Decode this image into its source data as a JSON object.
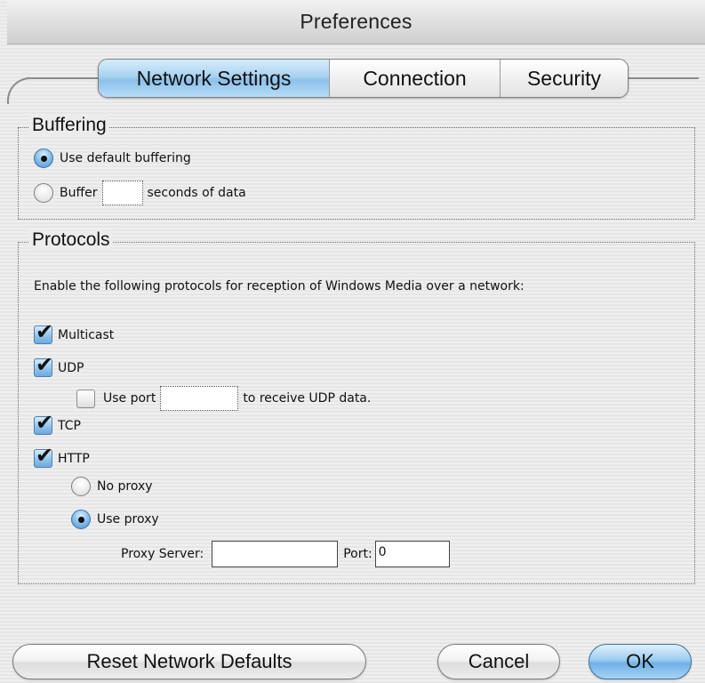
{
  "window": {
    "title": "Preferences"
  },
  "tabs": [
    {
      "label": "Network Settings",
      "active": true
    },
    {
      "label": "Connection",
      "active": false
    },
    {
      "label": "Security",
      "active": false
    }
  ],
  "buffering": {
    "title": "Buffering",
    "default_label": "Use default buffering",
    "default_selected": true,
    "buffer_label_pre": "Buffer",
    "buffer_value": "",
    "buffer_label_post": "seconds of data",
    "buffer_selected": false
  },
  "protocols": {
    "title": "Protocols",
    "description": "Enable the following protocols for reception of Windows Media over a network:",
    "multicast": {
      "label": "Multicast",
      "checked": true
    },
    "udp": {
      "label": "UDP",
      "checked": true
    },
    "udp_port": {
      "label_pre": "Use port",
      "value": "",
      "label_post": "to receive UDP data.",
      "checked": false
    },
    "tcp": {
      "label": "TCP",
      "checked": true
    },
    "http": {
      "label": "HTTP",
      "checked": true
    },
    "no_proxy": {
      "label": "No proxy",
      "selected": false
    },
    "use_proxy": {
      "label": "Use proxy",
      "selected": true
    },
    "proxy_server": {
      "label": "Proxy Server:",
      "value": ""
    },
    "proxy_port": {
      "label": "Port:",
      "value": "0"
    }
  },
  "buttons": {
    "reset": "Reset Network Defaults",
    "cancel": "Cancel",
    "ok": "OK"
  },
  "colors": {
    "accent": "#8cc1ea",
    "window_bg": "#ececec"
  }
}
